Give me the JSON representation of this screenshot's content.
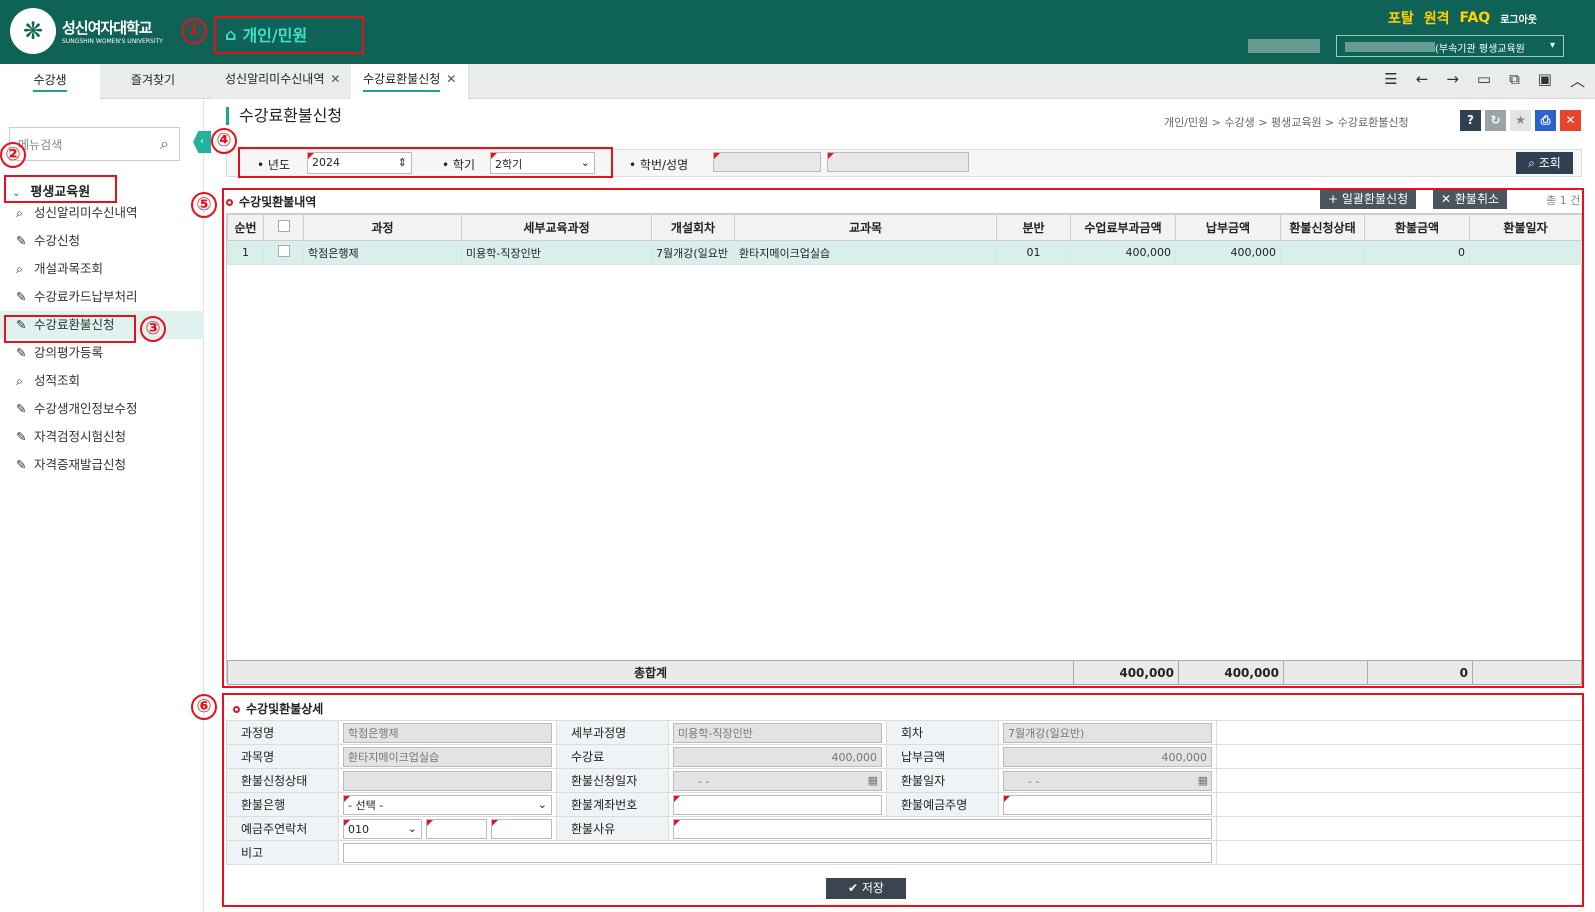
{
  "header": {
    "univ_name": "성신여자대학교",
    "univ_en": "SUNGSHIN WOMEN'S UNIVERSITY",
    "menu_title": "개인/민원",
    "links": {
      "portal": "포탈",
      "remote": "원격",
      "faq": "FAQ",
      "logout": "로그아웃"
    },
    "org_select": "(부속기관 평생교육원"
  },
  "badges": [
    "①",
    "②",
    "③",
    "④",
    "⑤",
    "⑥"
  ],
  "left_tabs": [
    "수강생",
    "즐겨찾기"
  ],
  "doc_tabs": [
    {
      "label": "성신알리미수신내역"
    },
    {
      "label": "수강료환불신청"
    }
  ],
  "sidebar": {
    "search_placeholder": "메뉴검색",
    "group": "평생교육원",
    "items": [
      {
        "label": "성신알리미수신내역",
        "icon": "search-icon"
      },
      {
        "label": "수강신청",
        "icon": "edit-icon"
      },
      {
        "label": "개설과목조회",
        "icon": "search-icon"
      },
      {
        "label": "수강료카드납부처리",
        "icon": "edit-icon"
      },
      {
        "label": "수강료환불신청",
        "icon": "edit-icon",
        "active": true
      },
      {
        "label": "강의평가등록",
        "icon": "edit-icon"
      },
      {
        "label": "성적조회",
        "icon": "search-icon"
      },
      {
        "label": "수강생개인정보수정",
        "icon": "edit-icon"
      },
      {
        "label": "자격검정시험신청",
        "icon": "edit-icon"
      },
      {
        "label": "자격증재발급신청",
        "icon": "edit-icon"
      }
    ]
  },
  "page": {
    "title": "수강료환불신청",
    "breadcrumb": "개인/민원 > 수강생 > 평생교육원 > 수강료환불신청"
  },
  "filter": {
    "year_label": "년도",
    "year_value": "2024",
    "term_label": "학기",
    "term_value": "2학기",
    "student_label": "학번/성명",
    "search_btn": "조회"
  },
  "list": {
    "title": "수강및환불내역",
    "bulk_btn": "일괄환불신청",
    "cancel_btn": "환불취소",
    "count": "총 1 건",
    "columns": [
      "순번",
      "",
      "과정",
      "세부교육과정",
      "개설회차",
      "교과목",
      "분반",
      "수업료부과금액",
      "납부금액",
      "환불신청상태",
      "환불금액",
      "환불일자"
    ],
    "rows": [
      {
        "no": "1",
        "course": "학점은행제",
        "sub": "미용학-직장인반",
        "round": "7월개강(일요반",
        "subject": "환타지메이크업실습",
        "cls": "01",
        "fee": "400,000",
        "paid": "400,000",
        "status": "",
        "refund": "0",
        "date": ""
      }
    ],
    "total": {
      "label": "총합계",
      "fee": "400,000",
      "paid": "400,000",
      "refund": "0"
    }
  },
  "detail": {
    "title": "수강및환불상세",
    "labels": {
      "course": "과정명",
      "sub": "세부과정명",
      "round": "회차",
      "subject": "과목명",
      "fee": "수강료",
      "paid": "납부금액",
      "status": "환불신청상태",
      "req_date": "환불신청일자",
      "refund_date": "환불일자",
      "bank": "환불은행",
      "account": "환불계좌번호",
      "holder": "환불예금주명",
      "phone": "예금주연락처",
      "reason": "환불사유",
      "note": "비고"
    },
    "values": {
      "course": "학점은행제",
      "sub": "미용학-직장인반",
      "round": "7월개강(일요반)",
      "subject": "환타지메이크업실습",
      "fee": "400,000",
      "paid": "400,000",
      "req_date": "-  -",
      "refund_date": "-  -",
      "bank": "- 선택 -",
      "phone": "010"
    },
    "save_btn": "저장"
  }
}
